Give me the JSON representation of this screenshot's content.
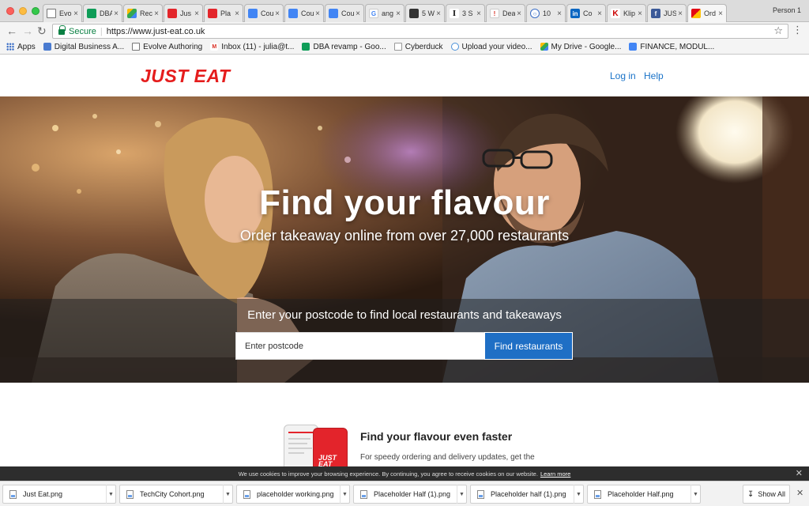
{
  "browser": {
    "tabs": [
      {
        "title": "Evo",
        "icon": "doc-icon"
      },
      {
        "title": "DBA",
        "icon": "sheets-icon"
      },
      {
        "title": "Rec",
        "icon": "drive-icon"
      },
      {
        "title": "Jus",
        "icon": "red-square-icon"
      },
      {
        "title": "Pla",
        "icon": "red-square-icon"
      },
      {
        "title": "Cou",
        "icon": "docs-icon"
      },
      {
        "title": "Cou",
        "icon": "docs-icon"
      },
      {
        "title": "Cou",
        "icon": "docs-icon"
      },
      {
        "title": "ang",
        "icon": "google-icon"
      },
      {
        "title": "5 W",
        "icon": "chart-icon"
      },
      {
        "title": "3 S",
        "icon": "i-icon"
      },
      {
        "title": "Dea",
        "icon": "bars-icon"
      },
      {
        "title": "10",
        "icon": "search-circle-icon"
      },
      {
        "title": "Co",
        "icon": "linkedin-icon"
      },
      {
        "title": "Klip",
        "icon": "k-icon"
      },
      {
        "title": "JUS",
        "icon": "facebook-icon"
      },
      {
        "title": "Ord",
        "icon": "justeat-icon",
        "active": true
      }
    ],
    "person": "Person 1",
    "secure_label": "Secure",
    "url": "https://www.just-eat.co.uk",
    "bookmarks": [
      {
        "label": "Apps"
      },
      {
        "label": "Digital Business A..."
      },
      {
        "label": "Evolve Authoring"
      },
      {
        "label": "Inbox (11) - julia@t..."
      },
      {
        "label": "DBA revamp - Goo..."
      },
      {
        "label": "Cyberduck"
      },
      {
        "label": "Upload your video..."
      },
      {
        "label": "My Drive - Google..."
      },
      {
        "label": "FINANCE, MODUL..."
      }
    ]
  },
  "site": {
    "logo": "JUST EAT",
    "nav": {
      "login": "Log in",
      "help": "Help"
    }
  },
  "hero": {
    "title": "Find your flavour",
    "subtitle": "Order takeaway online from over 27,000 restaurants",
    "search_label": "Enter your postcode to find local restaurants and takeaways",
    "input_placeholder": "Enter postcode",
    "button_label": "Find restaurants"
  },
  "promo": {
    "title": "Find your flavour even faster",
    "text": "For speedy ordering and delivery updates, get the",
    "phone_logo": "JUST EAT"
  },
  "cookie": {
    "text": "We use cookies to improve your browsing experience. By continuing, you agree to receive cookies on our website.",
    "link": "Learn more"
  },
  "downloads": {
    "items": [
      "Just Eat.png",
      "TechCity Cohort.png",
      "placeholder working.png",
      "Placeholder Half (1).png",
      "Placeholder half (1).png",
      "Placeholder Half.png"
    ],
    "show_all": "Show All"
  },
  "colors": {
    "brand_red": "#e51d1d",
    "link_blue": "#1a73c8",
    "button_blue": "#1f6fc5",
    "secure_green": "#0b8043"
  }
}
